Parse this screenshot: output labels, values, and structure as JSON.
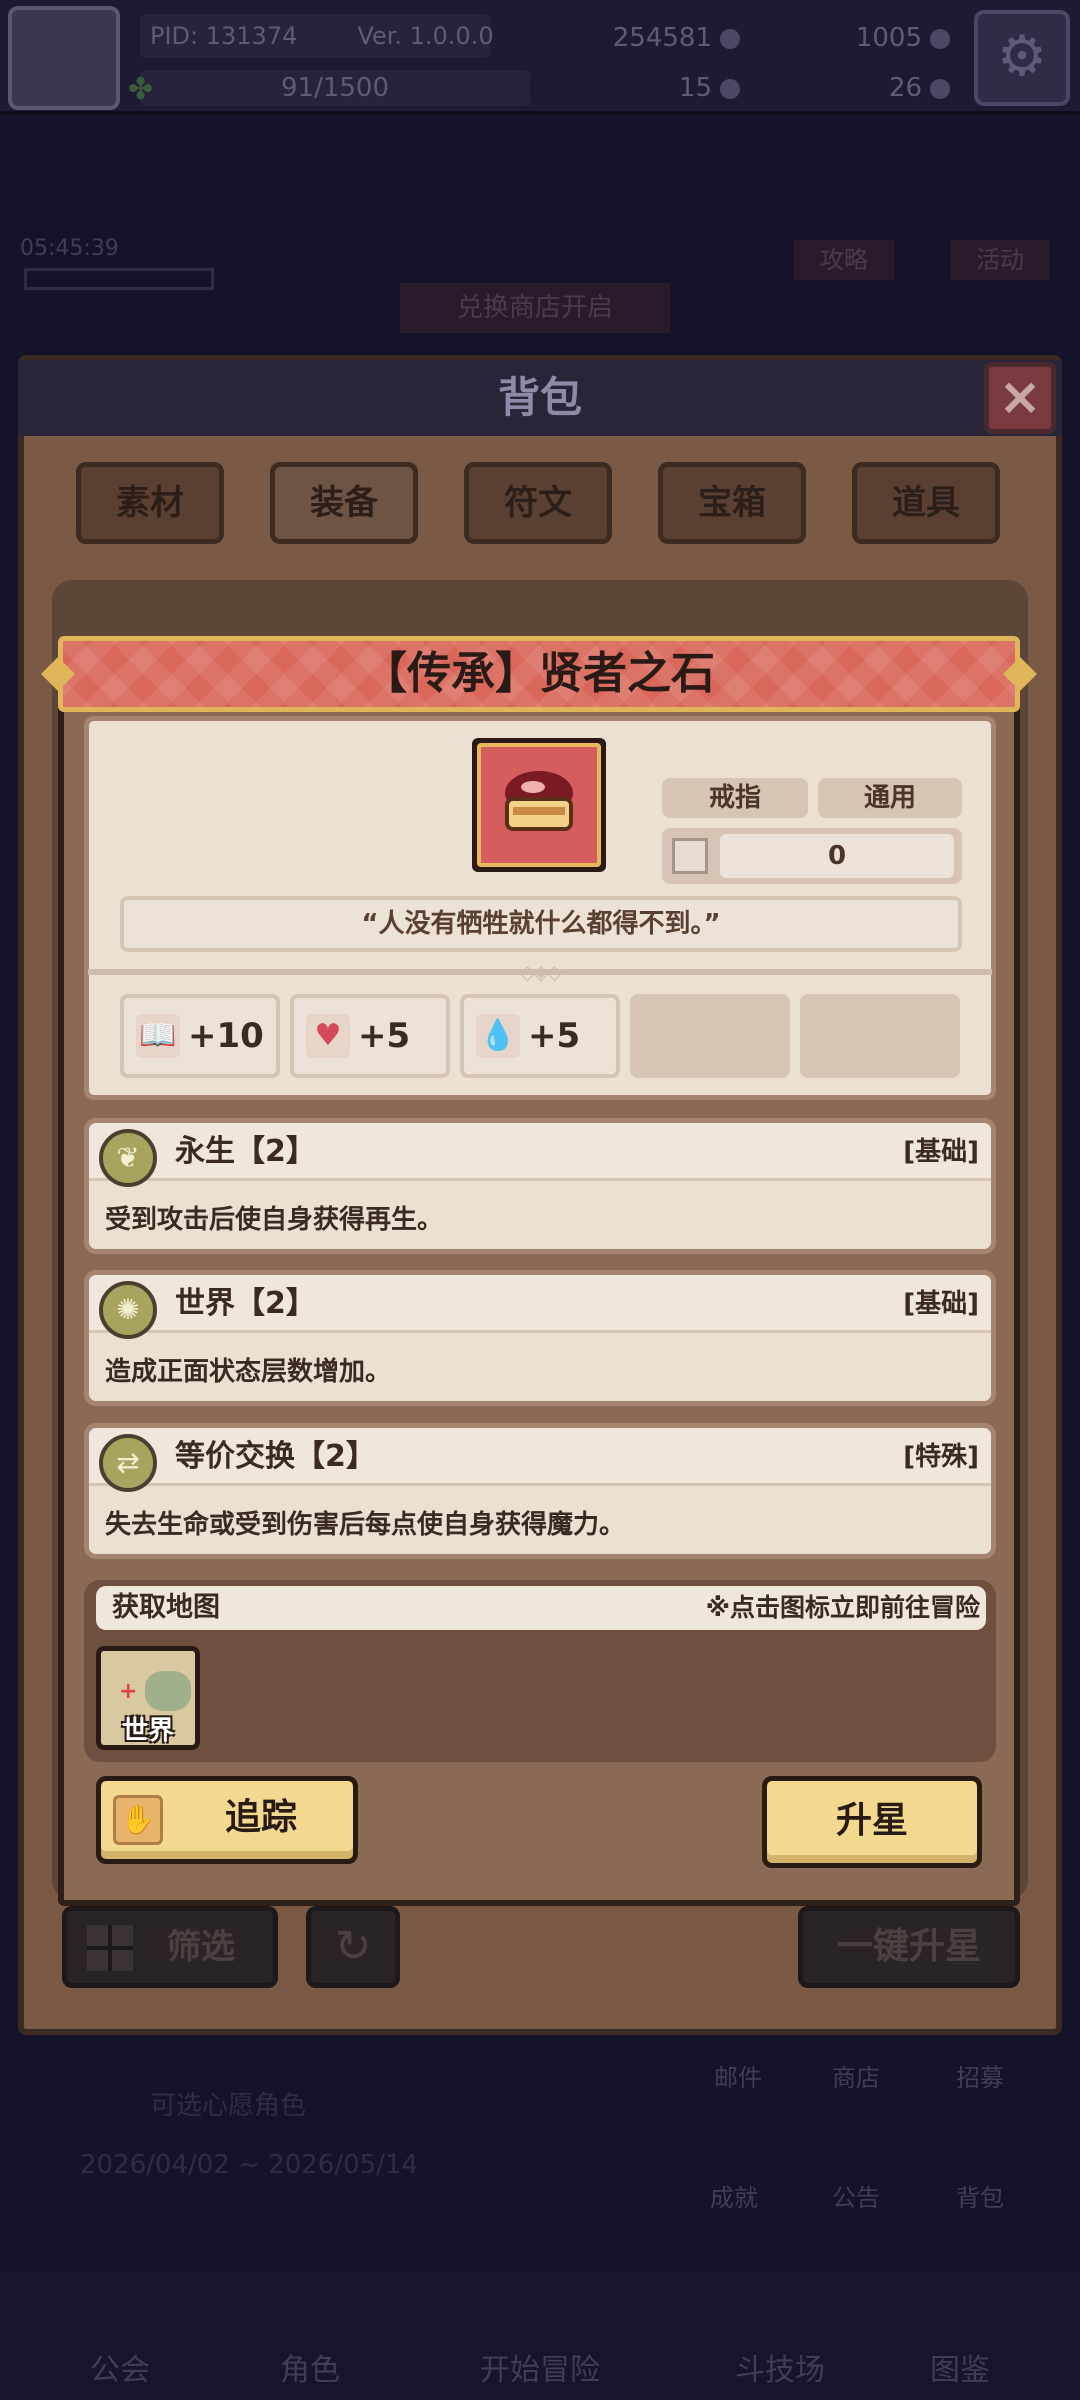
{
  "top_bar": {
    "pid": "PID: 131374",
    "version": "Ver. 1.0.0.0",
    "exp": "91/1500",
    "gold": "254581",
    "gems": "1005",
    "res3": "15",
    "res4": "26"
  },
  "background": {
    "timer": "05:45:39",
    "shop_banner": "兑换商店开启",
    "guide_btn": "攻略",
    "event_btn": "活动",
    "event_text": "可选心愿角色",
    "event_dates": "2026/04/02 ~ 2026/05/14",
    "side_icons": [
      "邮件",
      "商店",
      "招募",
      "成就",
      "公告",
      "背包"
    ],
    "nav": [
      "公会",
      "角色",
      "开始冒险",
      "斗技场",
      "图鉴"
    ]
  },
  "bag": {
    "title": "背包",
    "tabs": [
      "素材",
      "装备",
      "符文",
      "宝箱",
      "道具"
    ],
    "active_tab": "装备",
    "filter_label": "筛选",
    "star_all_label": "一键升星"
  },
  "item": {
    "title": "【传承】贤者之石",
    "tag_type": "戒指",
    "tag_class": "通用",
    "count": "0",
    "quote": "“人没有牺牲就什么都得不到。”",
    "stats": [
      {
        "icon": "book-icon",
        "value": "+10"
      },
      {
        "icon": "heart-icon",
        "value": "+5"
      },
      {
        "icon": "water-drop-icon",
        "value": "+5"
      }
    ],
    "skills": [
      {
        "name": "永生【2】",
        "type": "[基础]",
        "desc": "受到攻击后使自身获得再生。"
      },
      {
        "name": "世界【2】",
        "type": "[基础]",
        "desc": "造成正面状态层数增加。"
      },
      {
        "name": "等价交换【2】",
        "type": "[特殊]",
        "desc": "失去生命或受到伤害后每点使自身获得魔力。"
      }
    ],
    "map_title": "获取地图",
    "map_hint": "※点击图标立即前往冒险",
    "map_tile": "世界",
    "track_label": "追踪",
    "star_label": "升星"
  },
  "colors": {
    "header_red": "#d9675a",
    "gold_border": "#e0b65a",
    "card_bg": "#ebe0d2",
    "button_yellow": "#f2d98f"
  }
}
